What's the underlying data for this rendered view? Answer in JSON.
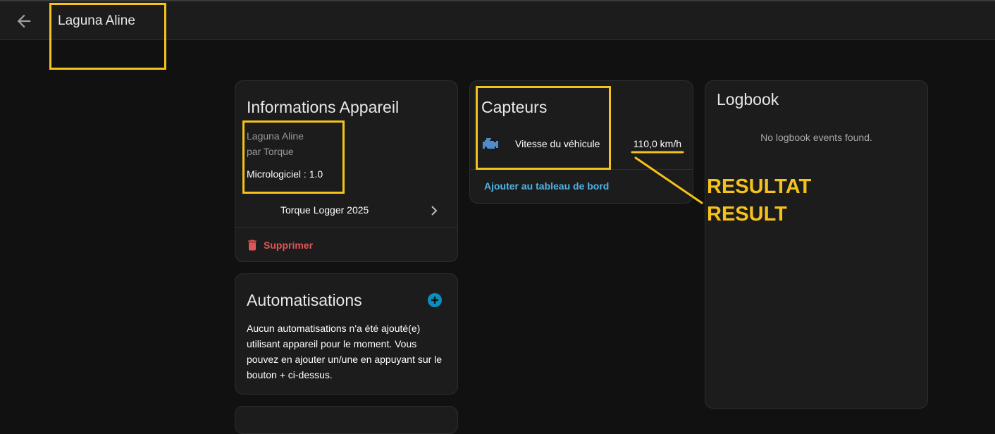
{
  "header": {
    "title": "Laguna Aline"
  },
  "device_info": {
    "title": "Informations Appareil",
    "device_name": "Laguna Aline",
    "manufacturer": "par Torque",
    "firmware_label": "Micrologiciel : 1.0",
    "integration": "Torque Logger 2025",
    "delete_label": "Supprimer"
  },
  "automations": {
    "title": "Automatisations",
    "empty_text": "Aucun automatisations n'a été ajouté(e) utilisant appareil pour le moment. Vous pouvez en ajouter un/une en appuyant sur le bouton + ci-dessus."
  },
  "sensors": {
    "title": "Capteurs",
    "items": [
      {
        "name": "Vitesse du véhicule",
        "value": "110,0 km/h",
        "icon": "engine-icon"
      }
    ],
    "add_to_dashboard": "Ajouter au tableau de bord"
  },
  "logbook": {
    "title": "Logbook",
    "empty_text": "No logbook events found."
  },
  "annotation": {
    "line1": "RESULTAT",
    "line2": "RESULT",
    "color": "#f5c21b"
  },
  "colors": {
    "background": "#111111",
    "card": "#1c1c1c",
    "accent_link": "#4fb4e6",
    "danger": "#e05555",
    "add_button": "#0a8fc2"
  }
}
